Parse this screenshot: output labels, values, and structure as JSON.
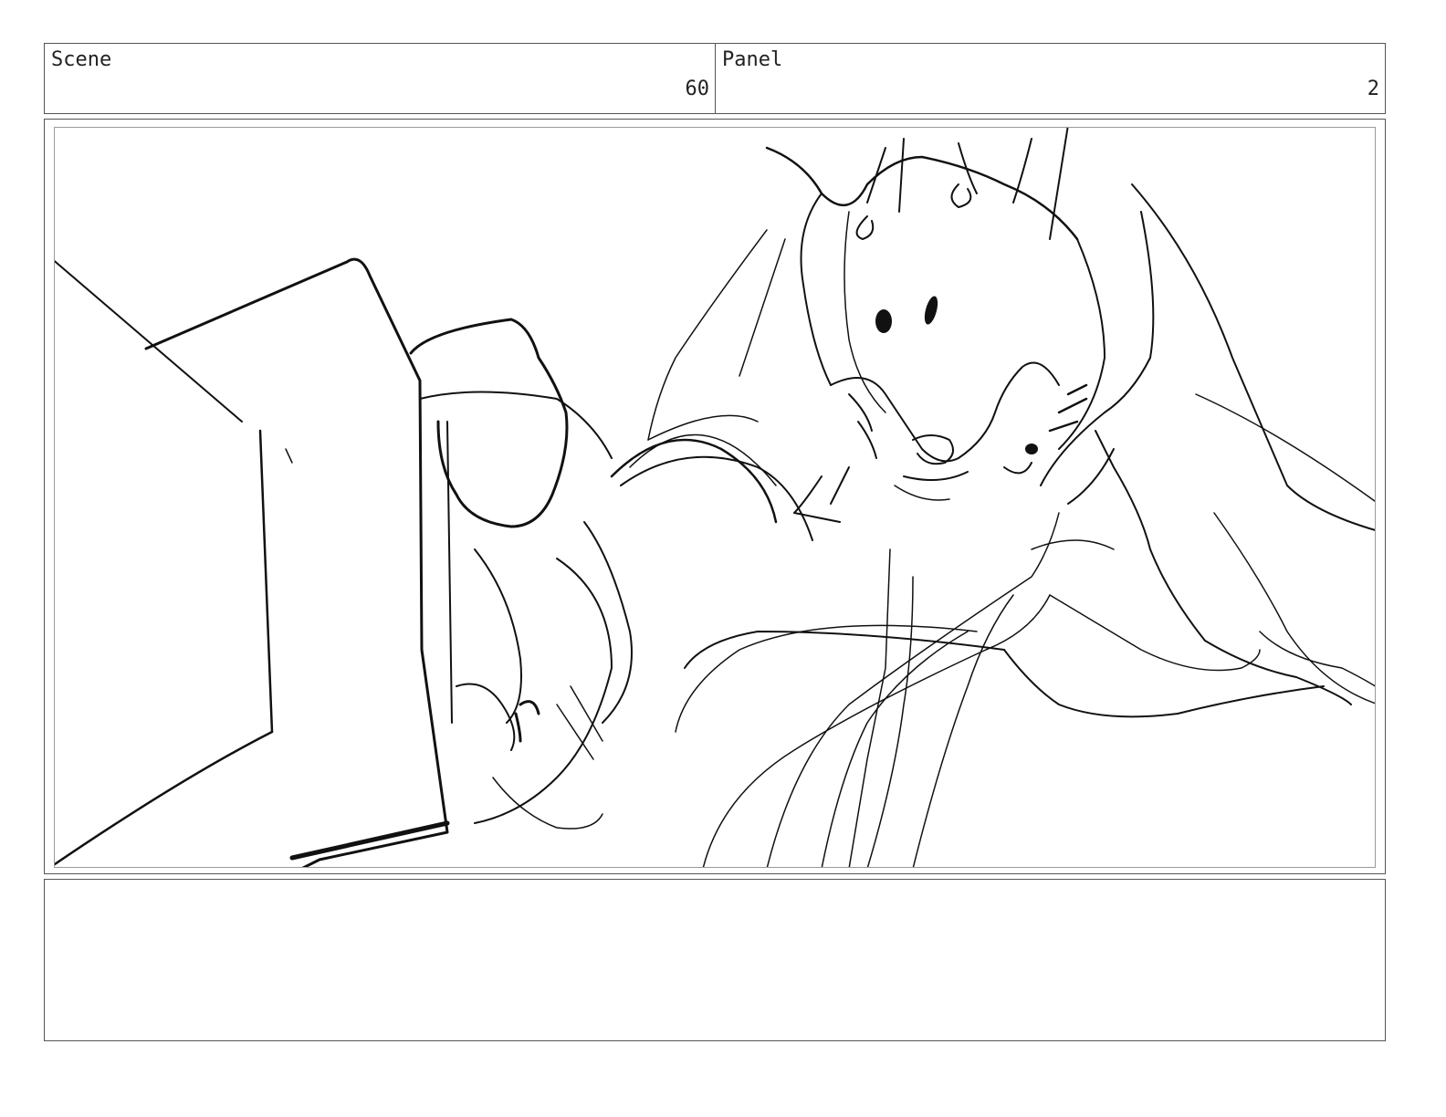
{
  "header": {
    "scene_label": "Scene",
    "scene_value": "60",
    "panel_label": "Panel",
    "panel_value": "2"
  },
  "frame": {
    "sketch_description_icon": "storyboard-sketch-drawing"
  },
  "notes": {
    "text": ""
  }
}
